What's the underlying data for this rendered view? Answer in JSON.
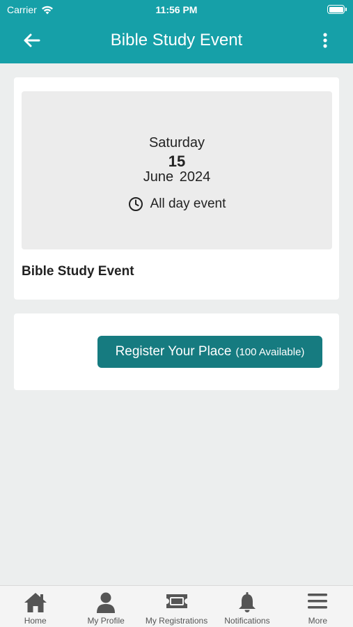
{
  "status_bar": {
    "carrier": "Carrier",
    "time": "11:56 PM"
  },
  "nav": {
    "title": "Bible Study Event"
  },
  "event": {
    "weekday": "Saturday",
    "day": "15",
    "month_year": "June  2024",
    "time_label": "All day event",
    "name": "Bible Study Event"
  },
  "register": {
    "label": "Register Your Place",
    "availability": "(100 Available)"
  },
  "tabs": [
    {
      "label": "Home",
      "icon": "home-icon"
    },
    {
      "label": "My Profile",
      "icon": "profile-icon"
    },
    {
      "label": "My Registrations",
      "icon": "ticket-icon"
    },
    {
      "label": "Notifications",
      "icon": "bell-icon"
    },
    {
      "label": "More",
      "icon": "menu-icon"
    }
  ],
  "colors": {
    "header": "#16a0a8",
    "button": "#167b80",
    "background": "#eceeee"
  }
}
